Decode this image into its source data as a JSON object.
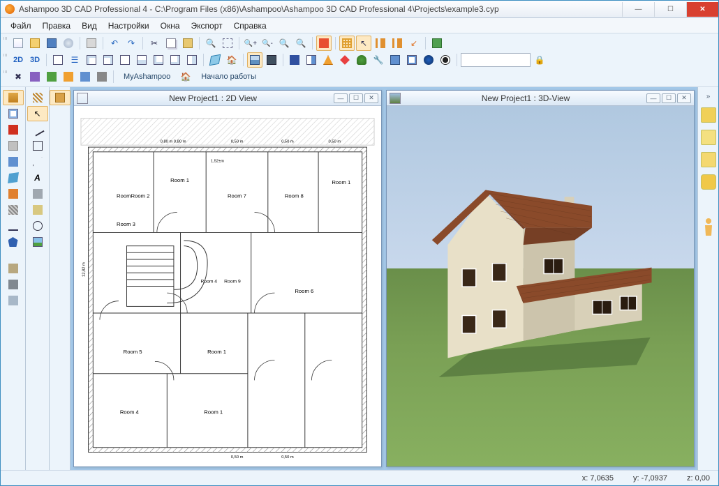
{
  "window": {
    "title": "Ashampoo 3D CAD Professional 4 - C:\\Program Files (x86)\\Ashampoo\\Ashampoo 3D CAD Professional 4\\Projects\\example3.cyp"
  },
  "menu": {
    "items": [
      "Файл",
      "Правка",
      "Вид",
      "Настройки",
      "Окна",
      "Экспорт",
      "Справка"
    ]
  },
  "toolbar1": {
    "icons": [
      "📄",
      "📂",
      "💾",
      "💿",
      "🖨",
      "↩",
      "↪",
      "✂",
      "📋",
      "📋",
      "🔍",
      "🔲",
      "🔍+",
      "🔍-",
      "🔍",
      "🔍",
      "⏹",
      "▦",
      "↗",
      "║",
      "║",
      "↙",
      "🔗"
    ]
  },
  "toolbar2": {
    "left_labels": [
      "2D",
      "3D"
    ],
    "icons": [
      "↔",
      "☰",
      "⊞",
      "⊞",
      "▭",
      "⊟",
      "⊞",
      "⊞",
      "⊟",
      "❐",
      "🏠",
      "🖼",
      "🎬",
      "■",
      "◧",
      "🔶",
      "🔷",
      "🏡",
      "🔧",
      "⊞",
      "▦",
      "🌐",
      "◉"
    ]
  },
  "toolbar3": {
    "label_my": "MyAshampoo",
    "label_start": "Начало работы"
  },
  "panel2d": {
    "title": "New Project1 : 2D View"
  },
  "panel3d": {
    "title": "New Project1 : 3D-View"
  },
  "rooms": {
    "r1": "Room 1",
    "r2": "Room 2",
    "r3": "Room 3",
    "r4": "Room 4",
    "r5": "Room 5",
    "r6": "Room 6",
    "r7": "Room 7",
    "r8": "Room 8",
    "r9": "Room 9",
    "rr2": "RoomRoom 2",
    "dim1": "0,50 m",
    "dim2": "0,80 m0,80 m",
    "dim3": "1,52±m"
  },
  "status": {
    "x": "x: 7,0635",
    "y": "y: -7,0937",
    "z": "z: 0,00"
  }
}
